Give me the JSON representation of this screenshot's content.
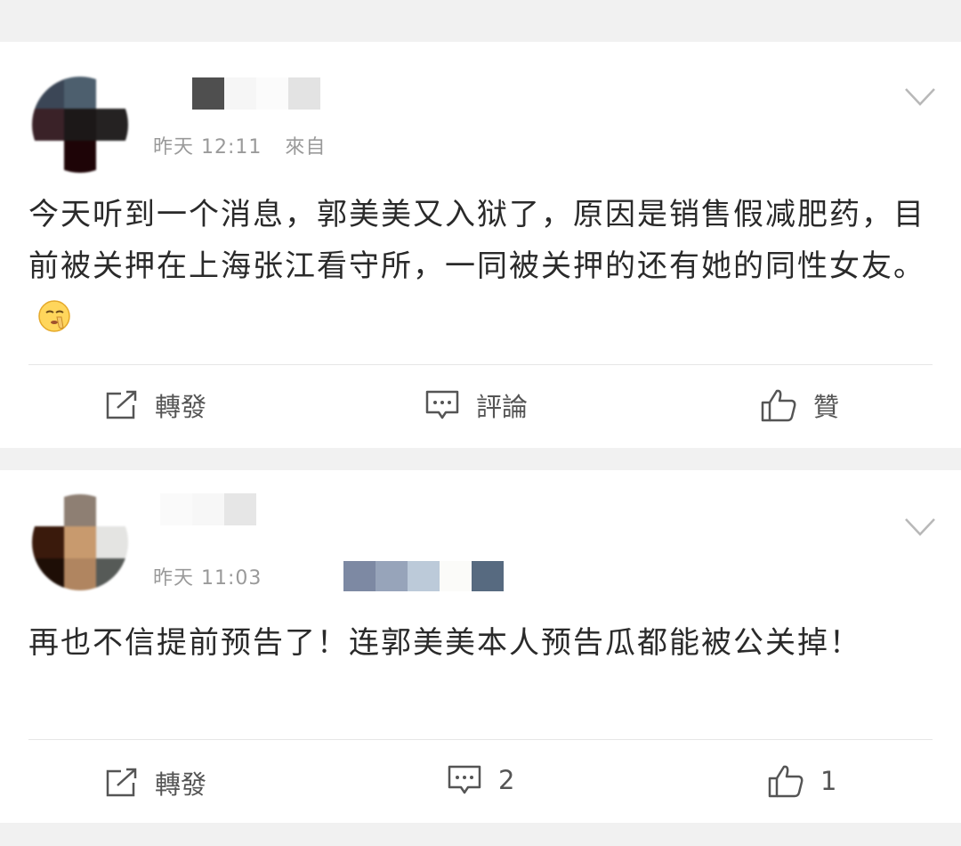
{
  "posts": [
    {
      "time": "昨天 12:11",
      "source_prefix": "來自",
      "content": "今天听到一个消息，郭美美又入狱了，原因是销售假减肥药，目前被关押在上海张江看守所，一同被关押的还有她的同性女友。",
      "emoji_icon": "shush-emoji-icon",
      "actions": {
        "repost_label": "轉發",
        "comment_label": "評論",
        "like_label": "贊"
      }
    },
    {
      "time": "昨天 11:03",
      "content": "再也不信提前预告了！连郭美美本人预告瓜都能被公关掉！",
      "actions": {
        "repost_label": "轉發",
        "comment_label": "2",
        "like_label": "1"
      }
    }
  ],
  "icons": {
    "repost": "repost-icon",
    "comment": "comment-icon",
    "like": "thumbs-up-icon",
    "menu": "chevron-down-icon"
  },
  "colors": {
    "background": "#f1f1f1",
    "card": "#ffffff",
    "meta_text": "#9a9a9a",
    "body_text": "#2a2a2a"
  }
}
